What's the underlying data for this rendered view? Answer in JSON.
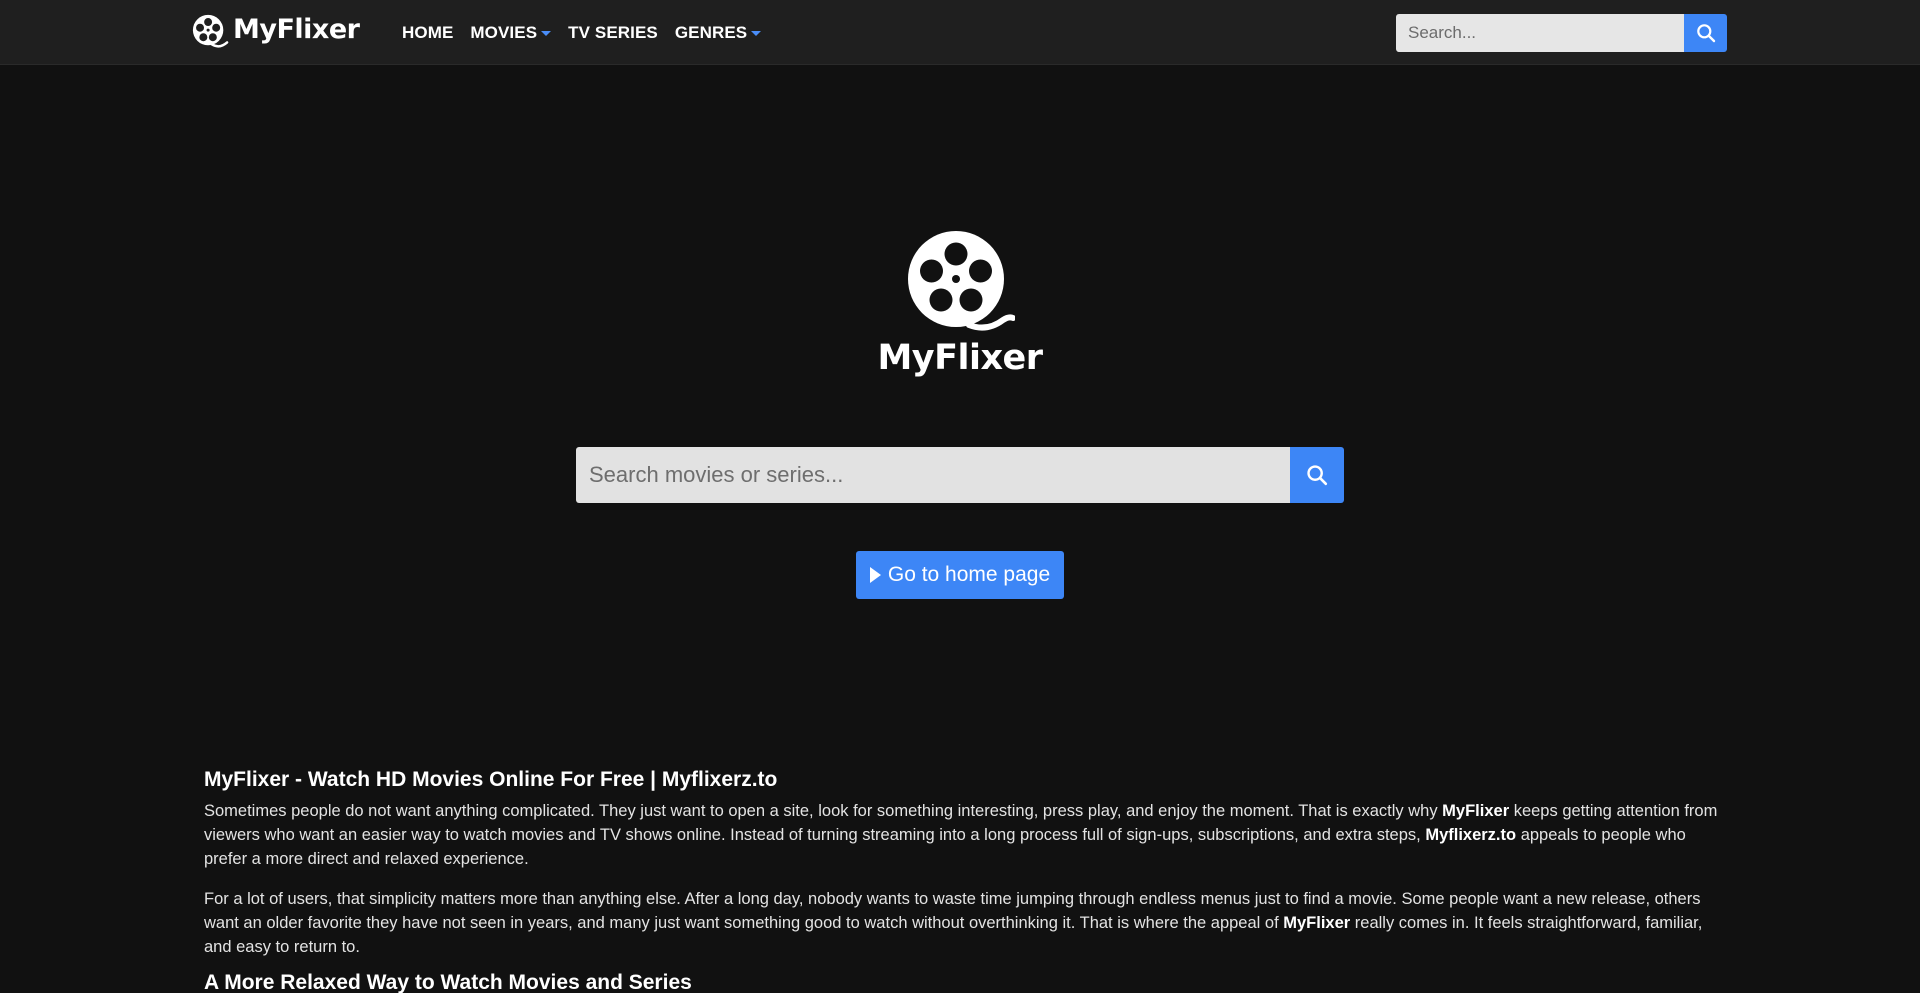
{
  "header": {
    "brand": "MyFlixer",
    "nav": [
      {
        "label": "HOME",
        "dropdown": false
      },
      {
        "label": "MOVIES",
        "dropdown": true
      },
      {
        "label": "TV SERIES",
        "dropdown": false
      },
      {
        "label": "GENRES",
        "dropdown": true
      }
    ],
    "search_placeholder": "Search..."
  },
  "hero": {
    "brand": "MyFlixer",
    "search_placeholder": "Search movies or series...",
    "home_button": "Go to home page"
  },
  "article": {
    "title": "MyFlixer - Watch HD Movies Online For Free | Myflixerz.to",
    "p1": {
      "a": "Sometimes people do not want anything complicated. They just want to open a site, look for something interesting, press play, and enjoy the moment. That is exactly why ",
      "b1": "MyFlixer",
      "c": " keeps getting attention from viewers who want an easier way to watch movies and TV shows online. Instead of turning streaming into a long process full of sign-ups, subscriptions, and extra steps, ",
      "b2": "Myflixerz.to",
      "d": " appeals to people who prefer a more direct and relaxed experience."
    },
    "p2": {
      "a": "For a lot of users, that simplicity matters more than anything else. After a long day, nobody wants to waste time jumping through endless menus just to find a movie. Some people want a new release, others want an older favorite they have not seen in years, and many just want something good to watch without overthinking it. That is where the appeal of ",
      "b1": "MyFlixer",
      "c": " really comes in. It feels straightforward, familiar, and easy to return to."
    },
    "subheading": "A More Relaxed Way to Watch Movies and Series"
  },
  "colors": {
    "background": "#111111",
    "header_bg": "#1f1f1f",
    "accent": "#3d86f6"
  },
  "icons": {
    "logo": "film-reel-icon",
    "search": "search-icon",
    "play": "play-icon",
    "dropdown": "caret-down-icon"
  }
}
